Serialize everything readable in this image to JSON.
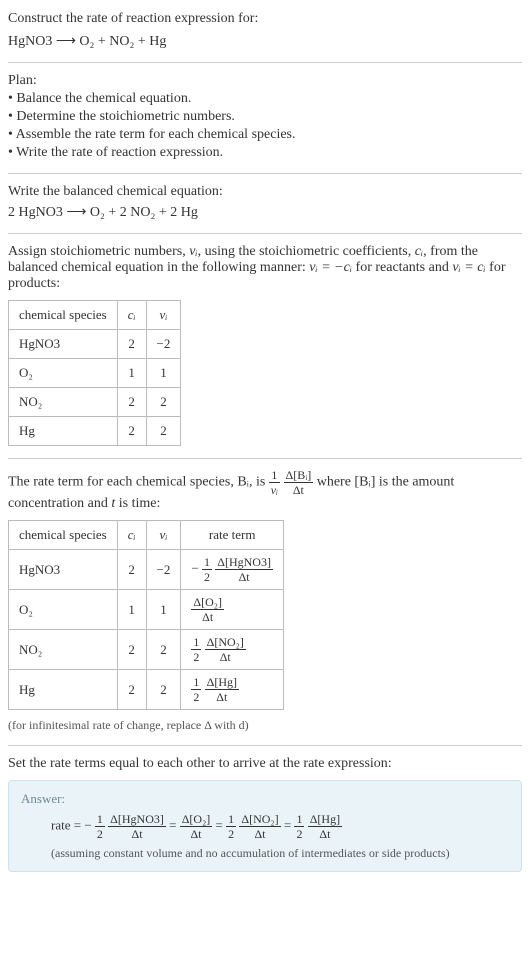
{
  "header": {
    "title": "Construct the rate of reaction expression for:",
    "equation": "HgNO3  ⟶  O₂ + NO₂ + Hg"
  },
  "plan": {
    "title": "Plan:",
    "items": [
      "• Balance the chemical equation.",
      "• Determine the stoichiometric numbers.",
      "• Assemble the rate term for each chemical species.",
      "• Write the rate of reaction expression."
    ]
  },
  "balanced": {
    "title": "Write the balanced chemical equation:",
    "equation": "2 HgNO3  ⟶  O₂ + 2 NO₂ + 2 Hg"
  },
  "stoich": {
    "intro_pre": "Assign stoichiometric numbers, ",
    "nu": "νᵢ",
    "intro_mid1": ", using the stoichiometric coefficients, ",
    "ci": "cᵢ",
    "intro_mid2": ", from the balanced chemical equation in the following manner: ",
    "rel1": "νᵢ = −cᵢ",
    "intro_mid3": " for reactants and ",
    "rel2": "νᵢ = cᵢ",
    "intro_end": " for products:",
    "cols": {
      "species": "chemical species",
      "ci": "cᵢ",
      "nu": "νᵢ"
    },
    "rows": [
      {
        "species": "HgNO3",
        "ci": "2",
        "nu": "−2"
      },
      {
        "species": "O₂",
        "ci": "1",
        "nu": "1"
      },
      {
        "species": "NO₂",
        "ci": "2",
        "nu": "2"
      },
      {
        "species": "Hg",
        "ci": "2",
        "nu": "2"
      }
    ]
  },
  "rateterm": {
    "intro_pre": "The rate term for each chemical species, Bᵢ, is ",
    "frac1_num": "1",
    "frac1_den": "νᵢ",
    "frac2_num": "Δ[Bᵢ]",
    "frac2_den": "Δt",
    "intro_mid": " where [Bᵢ] is the amount concentration and ",
    "t": "t",
    "intro_end": " is time:",
    "cols": {
      "species": "chemical species",
      "ci": "cᵢ",
      "nu": "νᵢ",
      "rate": "rate term"
    },
    "rows": [
      {
        "species": "HgNO3",
        "ci": "2",
        "nu": "−2",
        "coef_pre": "−",
        "coef_num": "1",
        "coef_den": "2",
        "dnum": "Δ[HgNO3]",
        "dden": "Δt"
      },
      {
        "species": "O₂",
        "ci": "1",
        "nu": "1",
        "coef_pre": "",
        "coef_num": "",
        "coef_den": "",
        "dnum": "Δ[O₂]",
        "dden": "Δt"
      },
      {
        "species": "NO₂",
        "ci": "2",
        "nu": "2",
        "coef_pre": "",
        "coef_num": "1",
        "coef_den": "2",
        "dnum": "Δ[NO₂]",
        "dden": "Δt"
      },
      {
        "species": "Hg",
        "ci": "2",
        "nu": "2",
        "coef_pre": "",
        "coef_num": "1",
        "coef_den": "2",
        "dnum": "Δ[Hg]",
        "dden": "Δt"
      }
    ],
    "note": "(for infinitesimal rate of change, replace Δ with d)"
  },
  "final": {
    "intro": "Set the rate terms equal to each other to arrive at the rate expression:",
    "answer_label": "Answer:",
    "rate_label": "rate = ",
    "minus": "−",
    "half_num": "1",
    "half_den": "2",
    "t1_num": "Δ[HgNO3]",
    "t1_den": "Δt",
    "eq": " = ",
    "t2_num": "Δ[O₂]",
    "t2_den": "Δt",
    "t3_num": "Δ[NO₂]",
    "t3_den": "Δt",
    "t4_num": "Δ[Hg]",
    "t4_den": "Δt",
    "assume": "(assuming constant volume and no accumulation of intermediates or side products)"
  },
  "chart_data": {
    "type": "table",
    "tables": [
      {
        "title": "Stoichiometric numbers",
        "columns": [
          "chemical species",
          "c_i",
          "nu_i"
        ],
        "rows": [
          [
            "HgNO3",
            2,
            -2
          ],
          [
            "O2",
            1,
            1
          ],
          [
            "NO2",
            2,
            2
          ],
          [
            "Hg",
            2,
            2
          ]
        ]
      },
      {
        "title": "Rate terms",
        "columns": [
          "chemical species",
          "c_i",
          "nu_i",
          "rate term"
        ],
        "rows": [
          [
            "HgNO3",
            2,
            -2,
            "-(1/2) Δ[HgNO3]/Δt"
          ],
          [
            "O2",
            1,
            1,
            "Δ[O2]/Δt"
          ],
          [
            "NO2",
            2,
            2,
            "(1/2) Δ[NO2]/Δt"
          ],
          [
            "Hg",
            2,
            2,
            "(1/2) Δ[Hg]/Δt"
          ]
        ]
      }
    ],
    "balanced_equation": "2 HgNO3 -> O2 + 2 NO2 + 2 Hg",
    "rate_expression": "rate = -(1/2) Δ[HgNO3]/Δt = Δ[O2]/Δt = (1/2) Δ[NO2]/Δt = (1/2) Δ[Hg]/Δt"
  }
}
